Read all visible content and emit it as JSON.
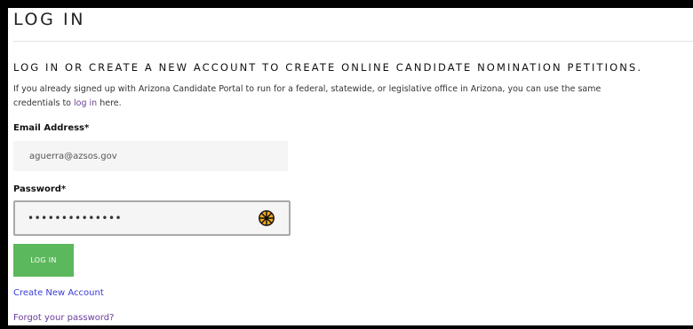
{
  "page": {
    "title": "LOG IN",
    "subheading": "LOG IN OR CREATE A NEW ACCOUNT TO CREATE ONLINE CANDIDATE NOMINATION PETITIONS.",
    "intro_line1": "If you already signed up with Arizona Candidate Portal to run for a federal, statewide, or legislative office in Arizona, you can use the same",
    "intro_line2_before": "credentials to ",
    "intro_link": "log in",
    "intro_line2_after": " here."
  },
  "form": {
    "email_label": "Email Address*",
    "email_value": "aguerra@azsos.gov",
    "password_label": "Password*",
    "password_value": "••••••••••••••",
    "login_button": "LOG IN"
  },
  "links": {
    "create_account": "Create New Account",
    "forgot_password": "Forgot your password?"
  },
  "icons": {
    "password_manager": "password-manager-icon"
  },
  "colors": {
    "login_button": "#5cb85c",
    "link_primary": "#3b3bd9",
    "link_visited": "#6a3d9a",
    "password_manager_icon": "#f0a81f"
  }
}
